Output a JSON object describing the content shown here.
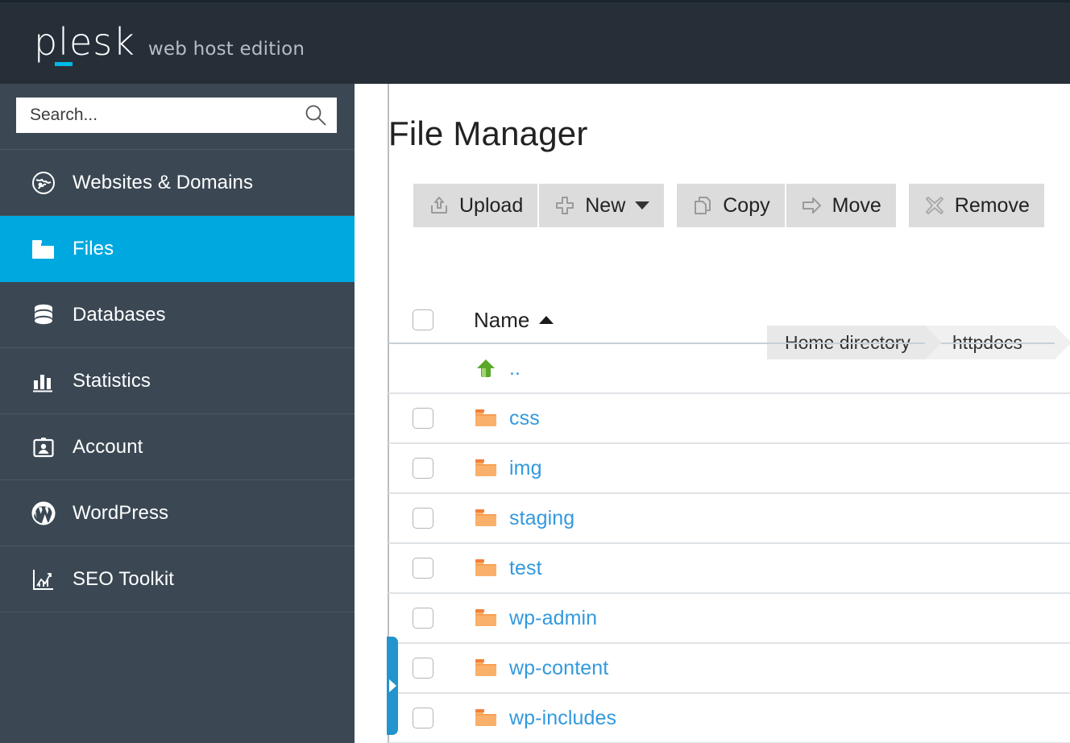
{
  "header": {
    "logo_text": "plesk",
    "logo_edition": "web host edition"
  },
  "sidebar": {
    "search": {
      "placeholder": "Search...",
      "value": "",
      "icon": "search-icon"
    },
    "items": [
      {
        "label": "Websites & Domains",
        "icon": "globe-icon",
        "active": false
      },
      {
        "label": "Files",
        "icon": "folder-icon",
        "active": true
      },
      {
        "label": "Databases",
        "icon": "database-icon",
        "active": false
      },
      {
        "label": "Statistics",
        "icon": "bar-chart-icon",
        "active": false
      },
      {
        "label": "Account",
        "icon": "id-badge-icon",
        "active": false
      },
      {
        "label": "WordPress",
        "icon": "wordpress-icon",
        "active": false
      },
      {
        "label": "SEO Toolkit",
        "icon": "seo-chart-icon",
        "active": false
      }
    ]
  },
  "main": {
    "title": "File Manager",
    "toolbar": [
      {
        "label": "Upload",
        "icon": "upload-icon",
        "has_caret": false
      },
      {
        "label": "New",
        "icon": "plus-icon",
        "has_caret": true
      },
      {
        "label": "Copy",
        "icon": "copy-icon",
        "has_caret": false
      },
      {
        "label": "Move",
        "icon": "move-arrow-icon",
        "has_caret": false
      },
      {
        "label": "Remove",
        "icon": "remove-x-icon",
        "has_caret": false
      }
    ],
    "breadcrumb": [
      {
        "label": "Home directory"
      },
      {
        "label": "httpdocs"
      }
    ],
    "table": {
      "columns": [
        {
          "label": "Name",
          "sort": "asc"
        }
      ],
      "rows": [
        {
          "name": "..",
          "icon": "up-arrow-green-icon",
          "has_checkbox": false
        },
        {
          "name": "css",
          "icon": "folder-orange-icon",
          "has_checkbox": true
        },
        {
          "name": "img",
          "icon": "folder-orange-icon",
          "has_checkbox": true
        },
        {
          "name": "staging",
          "icon": "folder-orange-icon",
          "has_checkbox": true
        },
        {
          "name": "test",
          "icon": "folder-orange-icon",
          "has_checkbox": true
        },
        {
          "name": "wp-admin",
          "icon": "folder-orange-icon",
          "has_checkbox": true
        },
        {
          "name": "wp-content",
          "icon": "folder-orange-icon",
          "has_checkbox": true
        },
        {
          "name": "wp-includes",
          "icon": "folder-orange-icon",
          "has_checkbox": true
        }
      ]
    },
    "side_tab": {
      "icon": "chevron-right-icon"
    }
  },
  "colors": {
    "header_bg": "#262f38",
    "sidebar_bg": "#3b4854",
    "active_item": "#00a8e0",
    "accent_cyan": "#00b9e4",
    "link_blue": "#3399dd",
    "folder_orange": "#f5a35c",
    "updir_green": "#74bb3a",
    "toolbar_btn": "#dcdcdc",
    "side_tab_blue": "#2494cc"
  }
}
